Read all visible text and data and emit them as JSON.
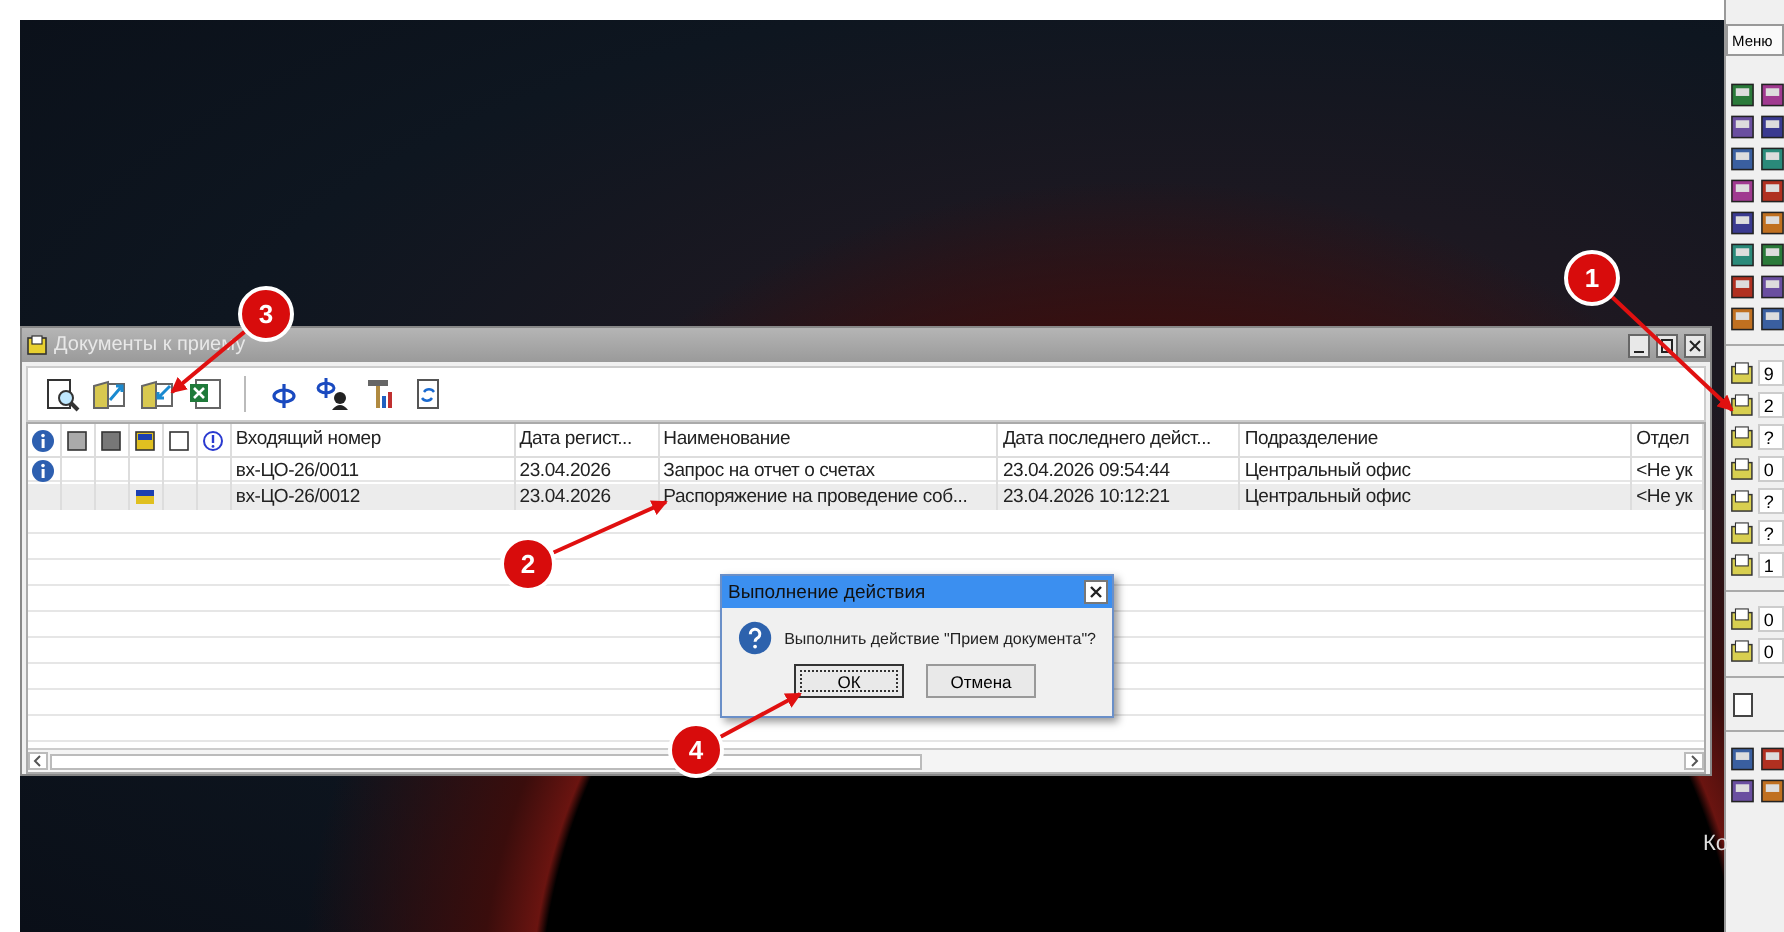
{
  "window": {
    "title": "Документы к приему"
  },
  "table": {
    "columns": [
      "Входящий номер",
      "Дата регист...",
      "Наименование",
      "Дата последнего дейст...",
      "Подразделение",
      "Отдел"
    ],
    "rows": [
      {
        "selected": false,
        "info": true,
        "marked": false,
        "cells": [
          "вх-ЦО-26/0011",
          "23.04.2026",
          "Запрос на отчет о счетах",
          "23.04.2026 09:54:44",
          "Центральный офис",
          "<Не ук"
        ]
      },
      {
        "selected": true,
        "info": false,
        "marked": true,
        "cells": [
          "вх-ЦО-26/0012",
          "23.04.2026",
          "Распоряжение на проведение соб...",
          "23.04.2026 10:12:21",
          "Центральный офис",
          "<Не ук"
        ]
      }
    ]
  },
  "dialog": {
    "title": "Выполнение действия",
    "message": "Выполнить действие \"Прием документа\"?",
    "buttons": [
      {
        "label": "ОК",
        "selected": true
      },
      {
        "label": "Отмена",
        "selected": false
      }
    ]
  },
  "side_panel": {
    "menu_tab": "Меню",
    "counters": [
      "9",
      "2",
      "?",
      "0",
      "?",
      "?",
      "1"
    ],
    "counters_2": [
      "0",
      "0"
    ]
  },
  "desktop_label": "Ко",
  "callouts": [
    {
      "label": "1"
    },
    {
      "label": "2"
    },
    {
      "label": "3"
    },
    {
      "label": "4"
    }
  ]
}
